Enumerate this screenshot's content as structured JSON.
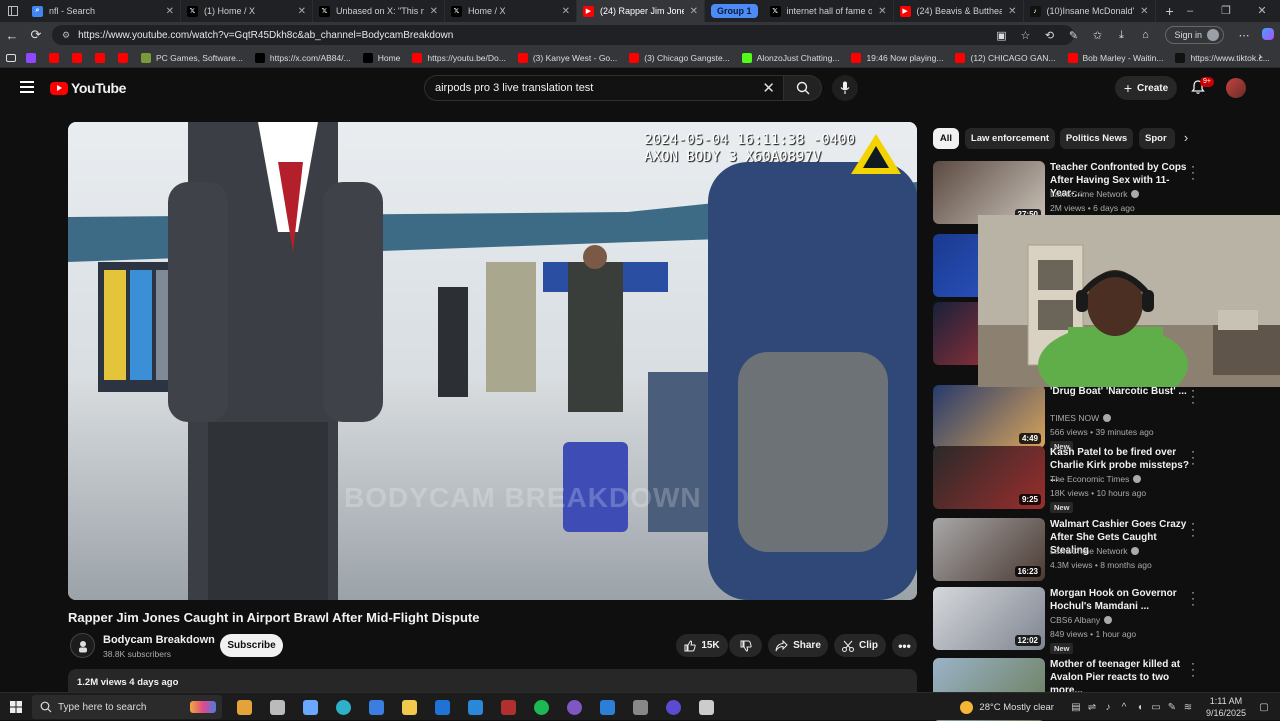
{
  "browser": {
    "tabs": [
      {
        "label": "nfl - Search",
        "icon": "search-icon",
        "color": "#4285f4"
      },
      {
        "label": "(1) Home / X",
        "icon": "x-logo-icon",
        "color": "#000000"
      },
      {
        "label": "Unbased on X: \"This n",
        "icon": "x-logo-icon",
        "color": "#000000"
      },
      {
        "label": "Home / X",
        "icon": "x-logo-icon",
        "color": "#000000"
      },
      {
        "label": "(24) Rapper Jim Jone",
        "icon": "youtube-icon",
        "color": "#ff0000",
        "active": true
      },
      {
        "label": "internet hall of fame on X",
        "icon": "x-logo-icon",
        "color": "#000000"
      },
      {
        "label": "(24) Beavis & Butthead -",
        "icon": "youtube-icon",
        "color": "#ff0000"
      },
      {
        "label": "(10)Insane McDonald's Fr",
        "icon": "tiktok-icon",
        "color": "#111111"
      }
    ],
    "group_label": "Group 1",
    "url": "https://www.youtube.com/watch?v=GqtR45Dkh8c&ab_channel=BodycamBreakdown",
    "signin_label": "Sign in",
    "bookmarks": [
      {
        "label": "",
        "color": "#9146ff"
      },
      {
        "label": "",
        "color": "#ff0000"
      },
      {
        "label": "",
        "color": "#ff0000"
      },
      {
        "label": "",
        "color": "#ff0000"
      },
      {
        "label": "",
        "color": "#ff0000"
      },
      {
        "label": "PC Games, Software...",
        "color": "#7a9a3a"
      },
      {
        "label": "https://x.com/AB84/...",
        "color": "#000000"
      },
      {
        "label": "Home",
        "color": "#000000"
      },
      {
        "label": "https://youtu.be/Do...",
        "color": "#ff0000"
      },
      {
        "label": "(3) Kanye West - Go...",
        "color": "#ff0000"
      },
      {
        "label": "(3) Chicago Gangste...",
        "color": "#ff0000"
      },
      {
        "label": "AlonzoJust Chatting...",
        "color": "#53fc18"
      },
      {
        "label": "19:46 Now playing...",
        "color": "#ff0000"
      },
      {
        "label": "(12) CHICAGO GAN...",
        "color": "#ff0000"
      },
      {
        "label": "Bob Marley - Waitin...",
        "color": "#ff0000"
      },
      {
        "label": "https://www.tiktok.c...",
        "color": "#111111"
      }
    ]
  },
  "youtube": {
    "logo_text": "YouTube",
    "search_query": "airpods pro 3 live translation test",
    "create_label": "Create",
    "notif_badge": "9+",
    "video": {
      "overlay_line1": "2024-05-04 16:11:38 -0400",
      "overlay_line2": "AXON BODY 3 X60A0897V",
      "watermark": "BODYCAM BREAKDOWN",
      "title": "Rapper Jim Jones Caught in Airport Brawl After Mid-Flight Dispute",
      "channel": "Bodycam Breakdown",
      "subscribers": "38.8K subscribers",
      "subscribe_label": "Subscribe",
      "likes": "15K",
      "share_label": "Share",
      "clip_label": "Clip",
      "views_date": "1.2M views  4 days ago"
    },
    "chips": [
      {
        "label": "All",
        "active": true
      },
      {
        "label": "Law enforcement"
      },
      {
        "label": "Politics News"
      },
      {
        "label": "Spor"
      }
    ],
    "recommendations": [
      {
        "title": "Teacher Confronted by Cops After Having Sex with 11-Year-...",
        "channel": "Law&Crime Network",
        "meta": "2M views • 6 days ago",
        "duration": "27:50",
        "thumb": [
          "#5b4a42",
          "#c9c2b8"
        ],
        "new": ""
      },
      {
        "title": "",
        "channel": "",
        "meta": "",
        "duration": "",
        "thumb": [
          "#1a3a8f",
          "#2f5bd1"
        ],
        "new": ""
      },
      {
        "title": "",
        "channel": "",
        "meta": "",
        "duration": "",
        "thumb": [
          "#17213a",
          "#c23636"
        ],
        "new": ""
      },
      {
        "title": "'Drug Boat' 'Narcotic Bust' ...",
        "channel": "TIMES NOW",
        "meta": "566 views • 39 minutes ago",
        "duration": "4:49",
        "thumb": [
          "#263a6b",
          "#d8a35b"
        ],
        "new": "New"
      },
      {
        "title": "Kash Patel to be fired over Charlie Kirk probe missteps? ...",
        "channel": "The Economic Times",
        "meta": "18K views • 10 hours ago",
        "duration": "9:25",
        "thumb": [
          "#2a2a2a",
          "#9b2d2d"
        ],
        "new": "New"
      },
      {
        "title": "Walmart Cashier Goes Crazy After She Gets Caught Stealing",
        "channel": "Law&Crime Network",
        "meta": "4.3M views • 8 months ago",
        "duration": "16:23",
        "thumb": [
          "#a8a7a8",
          "#4b3a33"
        ],
        "new": ""
      },
      {
        "title": "Morgan Hook on Governor Hochul's Mamdani ...",
        "channel": "CBS6 Albany",
        "meta": "849 views • 1 hour ago",
        "duration": "12:02",
        "thumb": [
          "#d6d8dc",
          "#7e8590"
        ],
        "new": "New"
      },
      {
        "title": "Mother of teenager killed at Avalon Pier reacts to two more...",
        "channel": "",
        "meta": "",
        "duration": "",
        "thumb": [
          "#9ab3c8",
          "#6a7c58"
        ],
        "new": ""
      }
    ]
  },
  "taskbar": {
    "search_placeholder": "Type here to search",
    "weather": "28°C  Mostly clear",
    "time": "1:11 AM",
    "date": "9/16/2025",
    "apps": [
      {
        "icon": "widgets-icon",
        "color": "#e4a23a"
      },
      {
        "icon": "task-view-icon",
        "color": "#bbbbbb"
      },
      {
        "icon": "copilot-icon",
        "color": "#6aa8ff"
      },
      {
        "icon": "edge-icon",
        "color": "#2fb0c9"
      },
      {
        "icon": "store-icon",
        "color": "#3b7de0"
      },
      {
        "icon": "file-explorer-icon",
        "color": "#f2c94c"
      },
      {
        "icon": "outlook-icon",
        "color": "#1f72d6"
      },
      {
        "icon": "photos-icon",
        "color": "#2b88d8"
      },
      {
        "icon": "media-icon",
        "color": "#b03030"
      },
      {
        "icon": "spotify-icon",
        "color": "#1db954"
      },
      {
        "icon": "chrome-icon",
        "color": "#7e57c2"
      },
      {
        "icon": "vscode-icon",
        "color": "#2b7fd6"
      },
      {
        "icon": "capture-icon",
        "color": "#888888"
      },
      {
        "icon": "media-player-icon",
        "color": "#5a4bd1"
      },
      {
        "icon": "security-icon",
        "color": "#cccccc"
      }
    ]
  }
}
